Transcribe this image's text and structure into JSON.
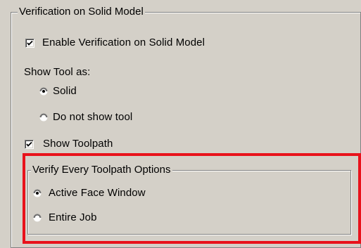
{
  "verification_group": {
    "caption": "Verification on Solid Model",
    "enable_checkbox": {
      "label": "Enable Verification on Solid Model",
      "checked": true
    },
    "show_tool_as_label": "Show Tool as:",
    "tool_options": [
      {
        "label": "Solid",
        "selected": true
      },
      {
        "label": "Do not show tool",
        "selected": false
      }
    ],
    "show_toolpath_checkbox": {
      "label": "Show Toolpath",
      "checked": true
    }
  },
  "toolpath_options_group": {
    "caption": "Verify Every Toolpath Options",
    "options": [
      {
        "label": "Active Face Window",
        "selected": true
      },
      {
        "label": "Entire Job",
        "selected": false
      }
    ]
  },
  "highlight_color": "#e8121b"
}
